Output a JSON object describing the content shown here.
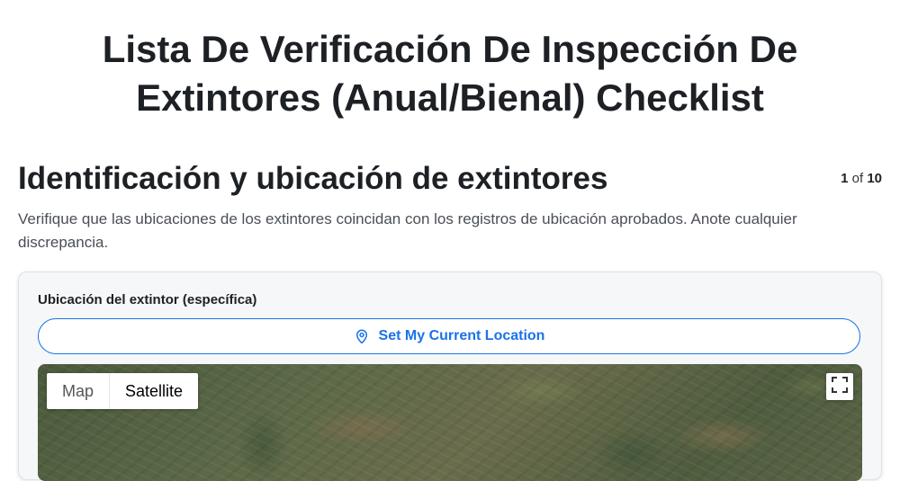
{
  "page": {
    "title": "Lista De Verificación De Inspección De Extintores (Anual/Bienal) Checklist"
  },
  "section": {
    "title": "Identificación y ubicación de extintores",
    "description": "Verifique que las ubicaciones de los extintores coincidan con los registros de ubicación aprobados. Anote cualquier discrepancia.",
    "pager_current": "1",
    "pager_of": "of",
    "pager_total": "10"
  },
  "field": {
    "label": "Ubicación del extintor (específica)",
    "location_button": "Set My Current Location",
    "location_icon": "map-pin-icon"
  },
  "map": {
    "tabs": [
      "Map",
      "Satellite"
    ],
    "selected_tab": "Satellite",
    "fullscreen_icon": "fullscreen-icon"
  },
  "colors": {
    "accent": "#1a73e8",
    "title": "#1d2024",
    "card_bg": "#f5f7f9"
  }
}
